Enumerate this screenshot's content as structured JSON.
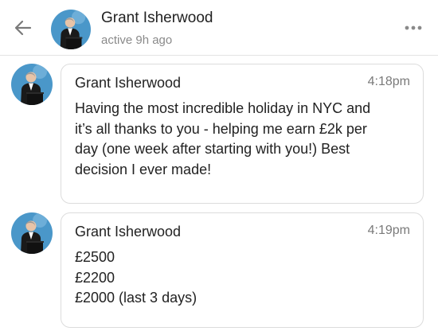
{
  "header": {
    "name": "Grant Isherwood",
    "status": "active 9h ago"
  },
  "messages": [
    {
      "sender": "Grant Isherwood",
      "time": "4:18pm",
      "lines": [
        "Having the most incredible holiday in NYC and",
        "it’s all thanks to you - helping me earn £2k per",
        "day (one week after starting with you!) Best",
        "decision I ever made!"
      ]
    },
    {
      "sender": "Grant Isherwood",
      "time": "4:19pm",
      "lines": [
        "£2500",
        "£2200",
        "£2000 (last 3 days)"
      ]
    }
  ],
  "icons": {
    "back": "back-arrow-icon",
    "more": "more-dots-icon"
  },
  "colors": {
    "avatar_bg": "#4a97c9",
    "border": "#dcdcdc",
    "muted_text": "#8a8a8a"
  }
}
